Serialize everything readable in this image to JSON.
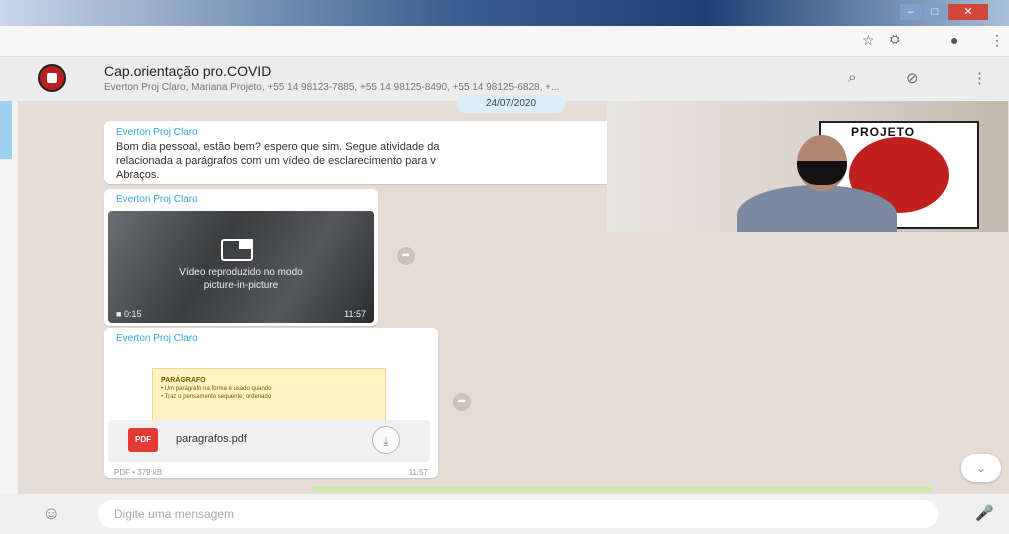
{
  "window": {
    "minimize_label": "–",
    "maximize_label": "□",
    "close_label": "✕"
  },
  "browser": {
    "icons": [
      "star-icon",
      "extension-icon",
      "profile-icon",
      "kebab-icon"
    ]
  },
  "chat": {
    "title": "Cap.orientação pro.COVID",
    "participants": "Everton Proj Claro, Mariana Projeto, +55 14 98123-7885, +55 14 98125-8490, +55 14 98125-6828, +..."
  },
  "date_divider": "24/07/2020",
  "messages": [
    {
      "sender": "Everton Proj Claro",
      "lines": [
        "Bom dia pessoal, estão bem? espero que sim. Segue atividade da",
        "relacionada a parágrafos com um vídeo de esclarecimento para v",
        "Abraços."
      ]
    },
    {
      "sender": "Everton Proj Claro",
      "video_caption_1": "Vídeo reproduzido no modo",
      "video_caption_2": "picture-in-picture",
      "views": "0:15",
      "time": "11:57"
    },
    {
      "sender": "Everton Proj Claro",
      "preview_heading": "PARÁGRAFO",
      "preview_line_1": "• Um parágrafo na forma é usado quando",
      "preview_line_2": "• Traz o pensamento sequente; ordenado",
      "file_badge": "PDF",
      "file_name": "paragrafos.pdf",
      "file_meta": "PDF • 379 kB",
      "time": "11:57"
    }
  ],
  "pip": {
    "poster_word": "PROJETO"
  },
  "composer": {
    "placeholder": "Digite uma mensagem"
  },
  "colors": {
    "chat_bg": "#e5ddd5",
    "sender": "#35a5d9",
    "header": "#ededed",
    "pdf_icon": "#e53935"
  }
}
